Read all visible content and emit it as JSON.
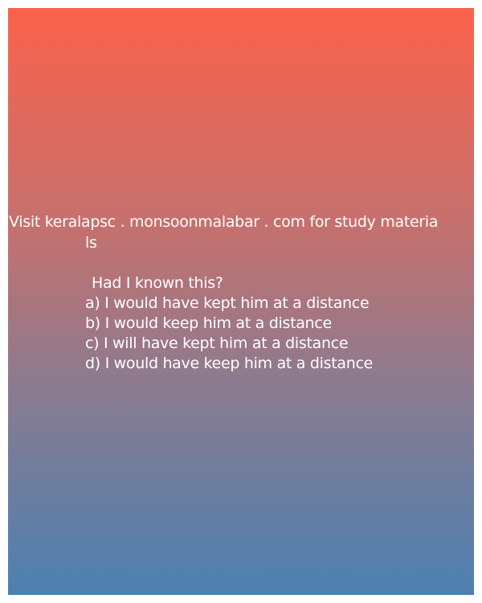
{
  "promo": {
    "line1": "Visit keralapsc . monsoonmalabar . com for study materia",
    "line2": "ls"
  },
  "question": "Had I known this?",
  "options": [
    "a) I would have kept him at a distance",
    "b) I would keep him at a distance",
    "c) I will have kept him at a distance",
    "d) I would have keep him at a distance"
  ],
  "colors": {
    "gradient_top": "#fb624b",
    "gradient_bottom": "#4c80b2",
    "text": "#ffffff"
  }
}
